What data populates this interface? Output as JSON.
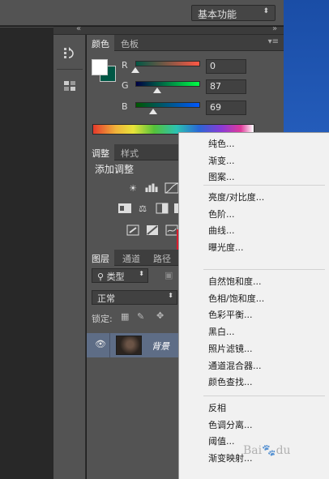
{
  "workspace": {
    "label": "基本功能"
  },
  "color_panel": {
    "tabs": [
      "颜色",
      "色板"
    ],
    "channels": [
      {
        "label": "R",
        "value": "0",
        "level": 0
      },
      {
        "label": "G",
        "value": "87",
        "level": 0.34
      },
      {
        "label": "B",
        "value": "69",
        "level": 0.27
      }
    ],
    "foreground": "#ffffff",
    "background": "#005745"
  },
  "adjust_panel": {
    "tabs": [
      "调整",
      "样式"
    ],
    "title": "添加调整"
  },
  "layers_panel": {
    "tabs": [
      "图层",
      "通道",
      "路径"
    ],
    "filter_kind": "类型",
    "blend_mode": "正常",
    "lock_label": "锁定:",
    "layer_name": "背景"
  },
  "menu": {
    "groups": [
      [
        "纯色...",
        "渐变...",
        "图案..."
      ],
      [
        "亮度/对比度...",
        "色阶...",
        "曲线...",
        "曝光度..."
      ],
      [
        "自然饱和度...",
        "色相/饱和度...",
        "色彩平衡...",
        "黑白...",
        "照片滤镜...",
        "通道混合器...",
        "颜色查找..."
      ],
      [
        "反相",
        "色调分离...",
        "阈值...",
        "渐变映射..."
      ]
    ],
    "highlighted": "曲线..."
  },
  "watermark": "Baidu"
}
